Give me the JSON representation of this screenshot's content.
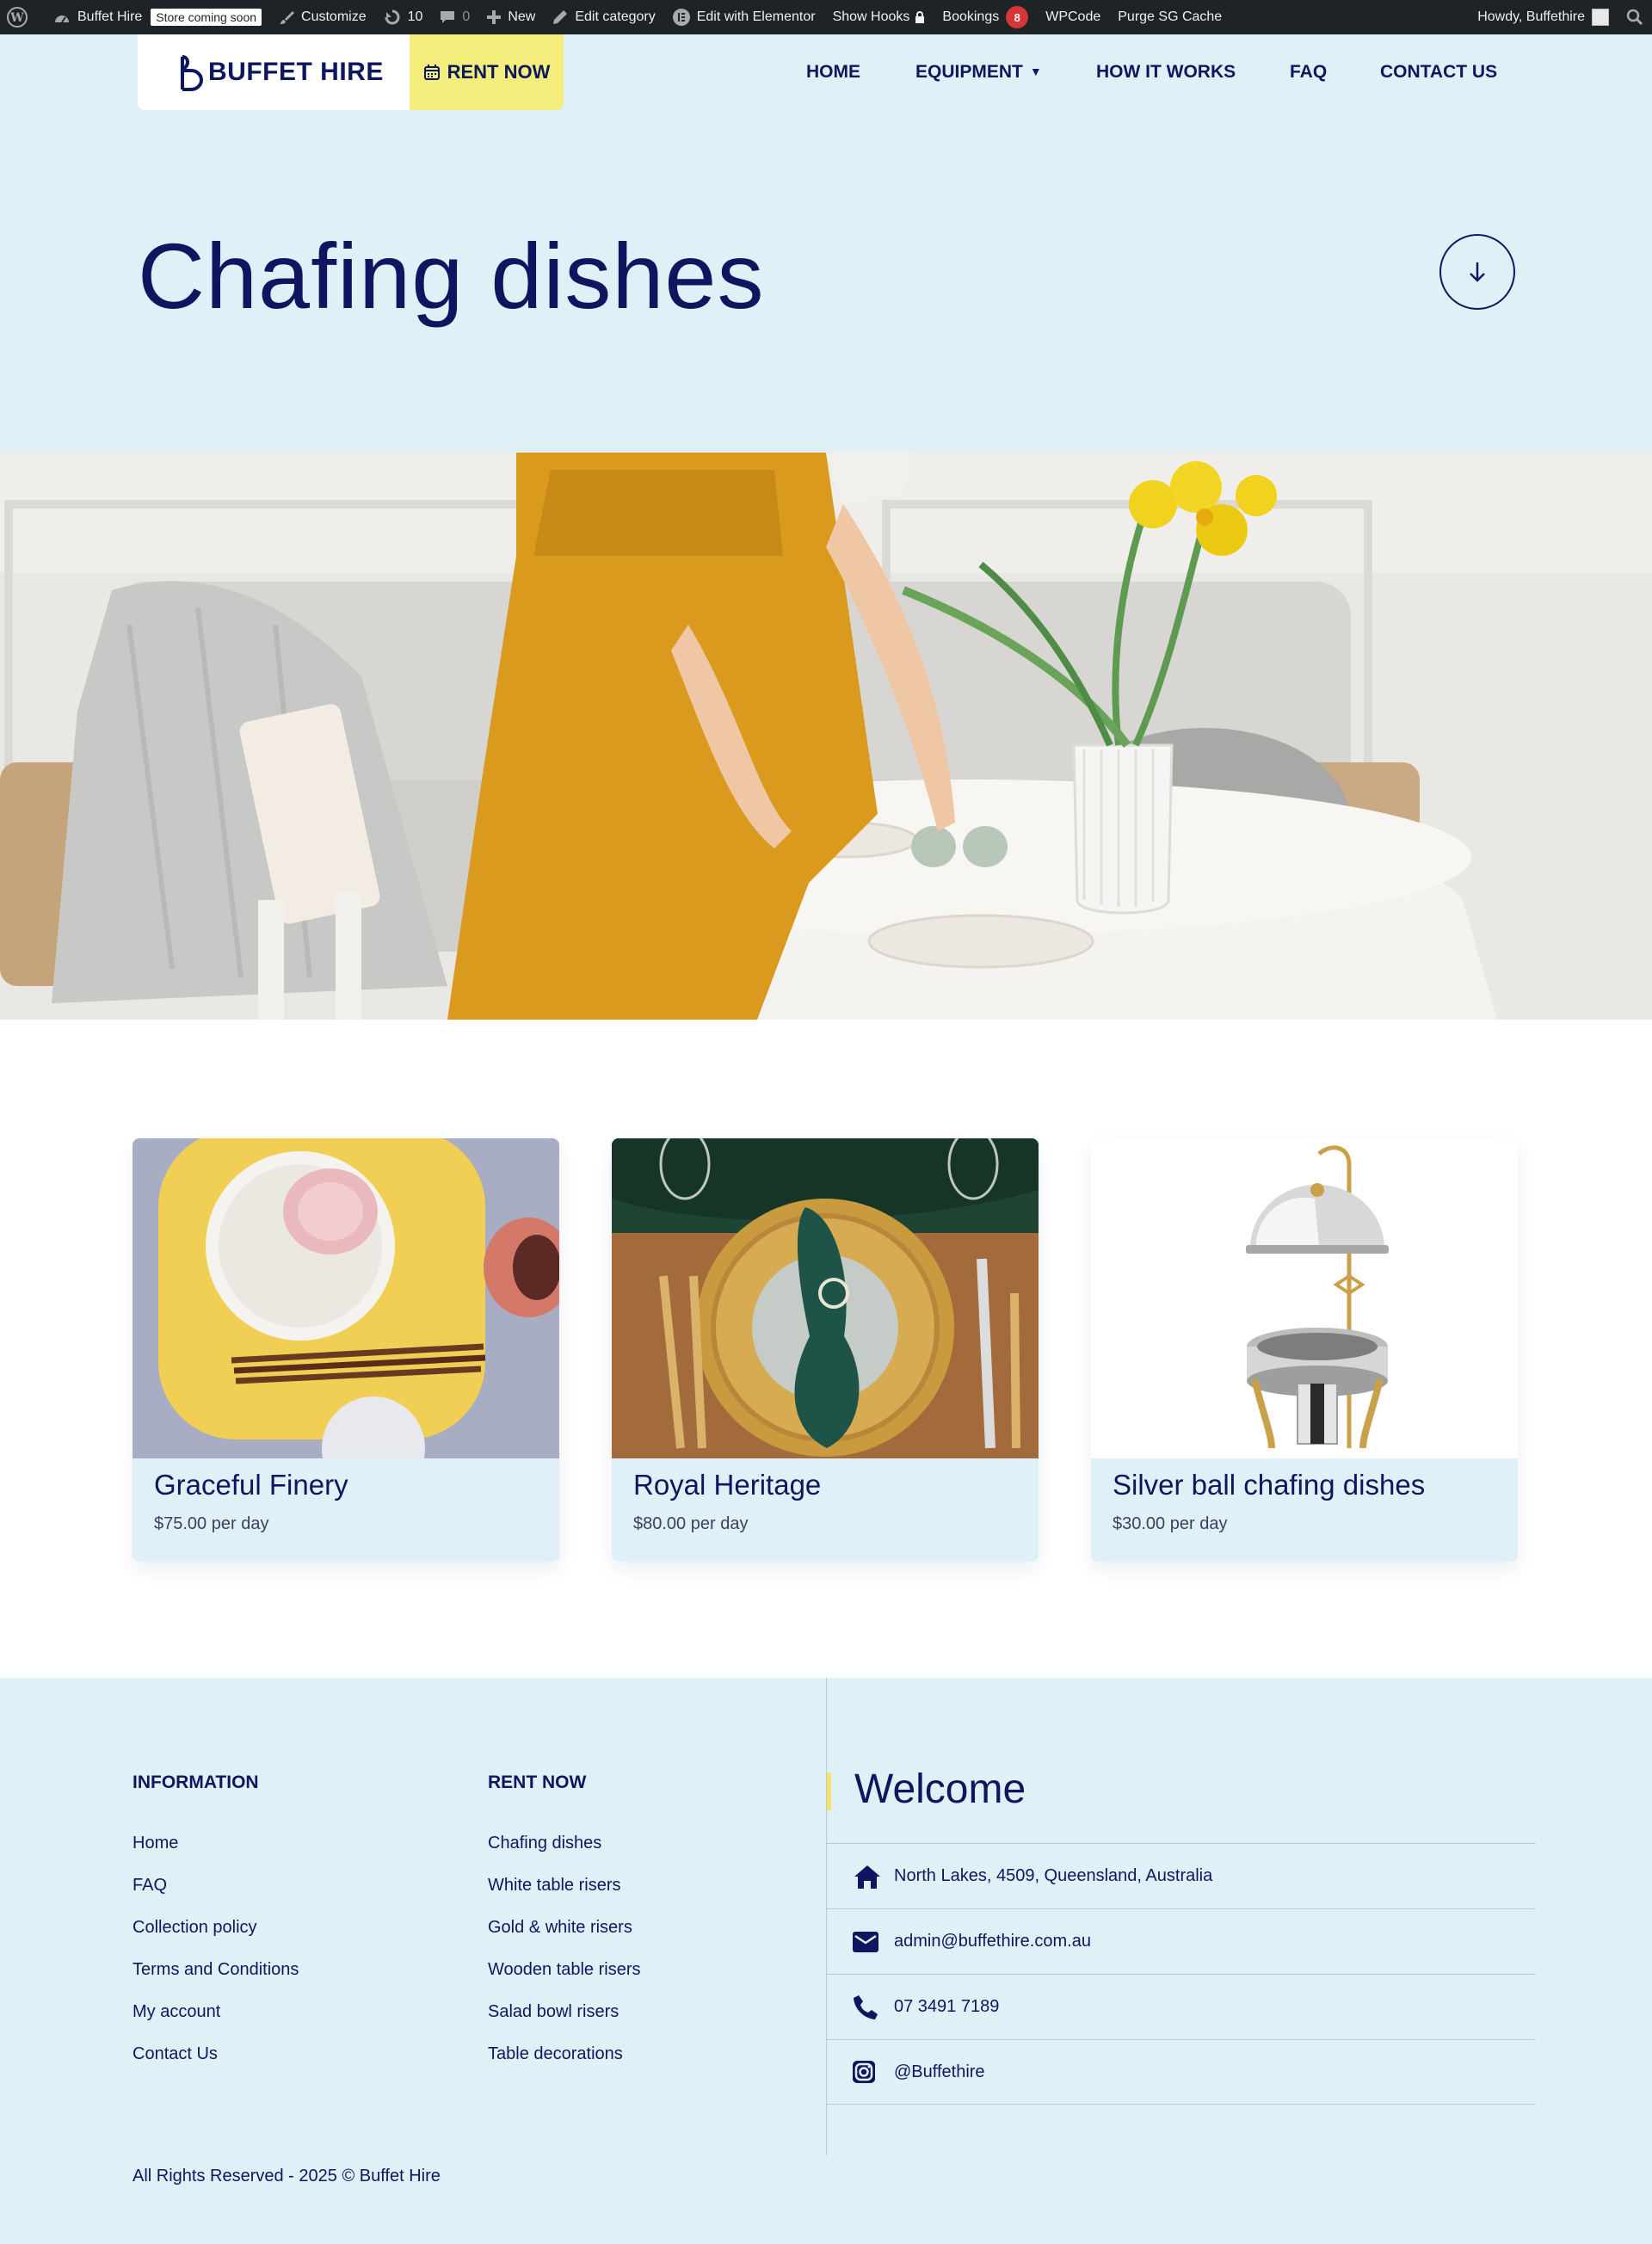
{
  "admin_bar": {
    "site_name": "Buffet Hire",
    "store_badge": "Store coming soon",
    "customize": "Customize",
    "updates_count": "10",
    "comments_count": "0",
    "new": "New",
    "edit_category": "Edit category",
    "edit_elementor": "Edit with Elementor",
    "show_hooks": "Show Hooks",
    "bookings": "Bookings",
    "bookings_count": "8",
    "wpcode": "WPCode",
    "purge_cache": "Purge SG Cache",
    "howdy": "Howdy, Buffethire"
  },
  "header": {
    "logo_text": "BUFFET HIRE",
    "rent_now": "RENT NOW",
    "nav": {
      "home": "HOME",
      "equipment": "EQUIPMENT",
      "how_it_works": "HOW IT WORKS",
      "faq": "FAQ",
      "contact": "CONTACT US"
    }
  },
  "hero": {
    "title": "Chafing dishes"
  },
  "products": [
    {
      "name": "Graceful Finery",
      "price": "$75.00 per day"
    },
    {
      "name": "Royal Heritage",
      "price": "$80.00 per day"
    },
    {
      "name": "Silver ball chafing dishes",
      "price": "$30.00 per day"
    }
  ],
  "footer": {
    "information": {
      "title": "INFORMATION",
      "links": [
        "Home",
        "FAQ",
        "Collection policy",
        "Terms and Conditions",
        "My account",
        "Contact Us"
      ]
    },
    "rent_now": {
      "title": "RENT NOW",
      "links": [
        "Chafing dishes",
        "White table risers",
        "Gold & white risers",
        "Wooden table risers",
        "Salad bowl risers",
        "Table decorations"
      ]
    },
    "welcome": "Welcome",
    "contact": {
      "address": "North Lakes, 4509, Queensland, Australia",
      "email": "admin@buffethire.com.au",
      "phone": "07 3491 7189",
      "instagram": "@Buffethire"
    },
    "copyright": "All Rights Reserved - 2025 © Buffet Hire"
  },
  "colors": {
    "navy": "#0d1760",
    "light_blue": "#dff1f7",
    "yellow": "#f3ee7c",
    "admin_bar": "#1d2327",
    "badge_red": "#d63638"
  }
}
